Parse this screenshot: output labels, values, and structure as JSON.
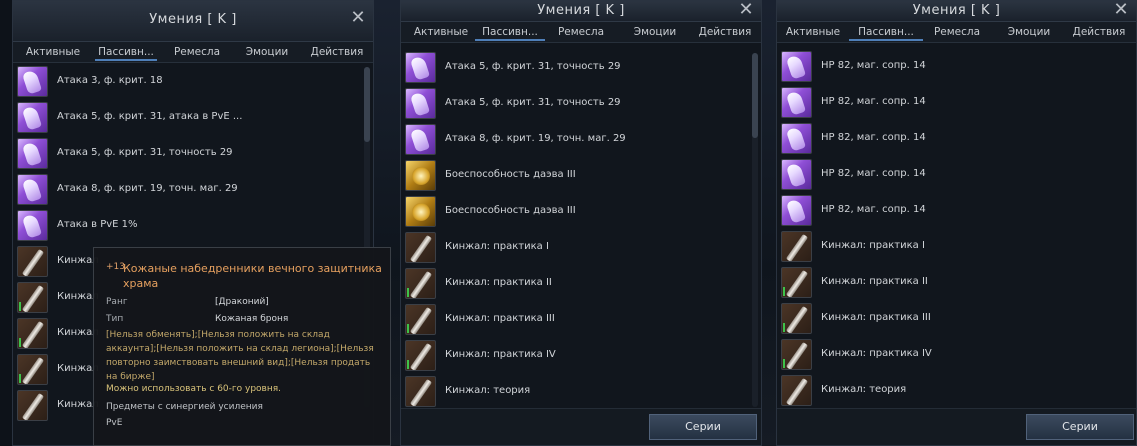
{
  "window_title": "Умения [ K ]",
  "tabs": [
    "Активные",
    "Пассивн...",
    "Ремесла",
    "Эмоции",
    "Действия"
  ],
  "series_button": "Серии",
  "close_glyph": "✕",
  "panel1": {
    "items": [
      {
        "label": "Атака 3, ф. крит. 18"
      },
      {
        "label": "Атака 5, ф. крит. 31, атака в PvE ..."
      },
      {
        "label": "Атака 5, ф. крит. 31, точность 29"
      },
      {
        "label": "Атака 8, ф. крит. 19, точн. маг. 29"
      },
      {
        "label": "Атака в PvE 1%"
      },
      {
        "label": "Кинжал"
      },
      {
        "label": "Кинжал"
      },
      {
        "label": "Кинжал"
      },
      {
        "label": "Кинжал"
      },
      {
        "label": "Кинжал"
      }
    ]
  },
  "panel2": {
    "items": [
      {
        "label": "Атака 5, ф. крит. 31, точность 29"
      },
      {
        "label": "Атака 5, ф. крит. 31, точность 29"
      },
      {
        "label": "Атака 8, ф. крит. 19, точн. маг. 29"
      },
      {
        "label": "Боеспособность даэва III"
      },
      {
        "label": "Боеспособность даэва III"
      },
      {
        "label": "Кинжал: практика I"
      },
      {
        "label": "Кинжал: практика II"
      },
      {
        "label": "Кинжал: практика III"
      },
      {
        "label": "Кинжал: практика IV"
      },
      {
        "label": "Кинжал: теория"
      }
    ]
  },
  "panel3": {
    "items": [
      {
        "label": "HP 82, маг. сопр. 14"
      },
      {
        "label": "HP 82, маг. сопр. 14"
      },
      {
        "label": "HP 82, маг. сопр. 14"
      },
      {
        "label": "HP 82, маг. сопр. 14"
      },
      {
        "label": "HP 82, маг. сопр. 14"
      },
      {
        "label": "Кинжал: практика I"
      },
      {
        "label": "Кинжал: практика II"
      },
      {
        "label": "Кинжал: практика III"
      },
      {
        "label": "Кинжал: практика IV"
      },
      {
        "label": "Кинжал: теория"
      }
    ]
  },
  "tooltip": {
    "enchant": "+13",
    "name": "Кожаные набедренники вечного защитника храма",
    "rank_label": "Ранг",
    "rank_value": "[Драконий]",
    "type_label": "Тип",
    "type_value": "Кожаная броня",
    "restrictions": "[Нельзя обменять];[Нельзя положить на склад аккаунта];[Нельзя положить на склад легиона];[Нельзя повторно заимствовать внешний вид];[Нельзя продать на бирже]",
    "level_req": "Можно использовать с 60-го уровня.",
    "synergy": "Предметы с синергией усиления",
    "pve": "PvE"
  }
}
